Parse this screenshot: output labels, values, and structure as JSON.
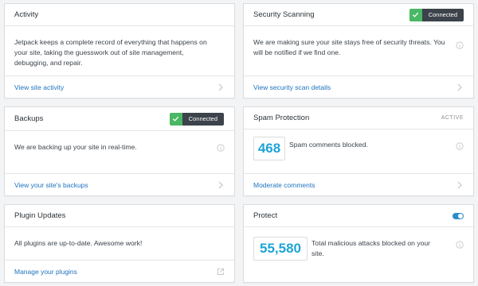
{
  "colors": {
    "accent": "#1e73be",
    "connected": "#4ab866",
    "stat": "#1ea4d6",
    "toggle_on": "#2e8cca"
  },
  "activity": {
    "title": "Activity",
    "description": "Jetpack keeps a complete record of everything that happens on your site, taking the guesswork out of site management, debugging, and repair.",
    "link": "View site activity"
  },
  "security": {
    "title": "Security Scanning",
    "badge": "Connected",
    "description": "We are making sure your site stays free of security threats. You will be notified if we find one.",
    "link": "View security scan details"
  },
  "backups": {
    "title": "Backups",
    "badge": "Connected",
    "description": "We are backing up your site in real-time.",
    "link": "View your site's backups"
  },
  "spam": {
    "title": "Spam Protection",
    "status": "ACTIVE",
    "count": "468",
    "description": "Spam comments blocked.",
    "link": "Moderate comments"
  },
  "plugins": {
    "title": "Plugin Updates",
    "description": "All plugins are up-to-date. Awesome work!",
    "link": "Manage your plugins"
  },
  "protect": {
    "title": "Protect",
    "toggle_on": true,
    "count": "55,580",
    "description": "Total malicious attacks blocked on your site."
  }
}
